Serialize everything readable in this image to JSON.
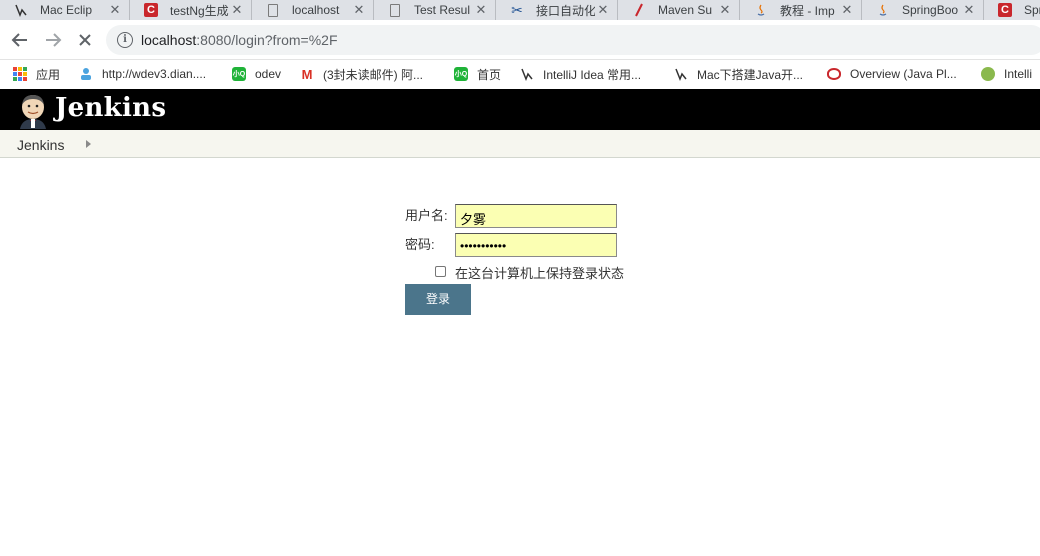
{
  "browser": {
    "tabs": [
      {
        "title": "Mac Eclip",
        "icon": "fork-icon"
      },
      {
        "title": "testNg生成",
        "icon": "c-red-icon"
      },
      {
        "title": "localhost",
        "icon": "page-icon"
      },
      {
        "title": "Test Resul",
        "icon": "page-icon"
      },
      {
        "title": "接口自动化",
        "icon": "scissors-icon"
      },
      {
        "title": "Maven Su",
        "icon": "pen-icon"
      },
      {
        "title": "教程 - Imp",
        "icon": "java-icon"
      },
      {
        "title": "SpringBoo",
        "icon": "java-icon"
      },
      {
        "title": "Spri",
        "icon": "c-red-icon"
      }
    ],
    "tab_close_glyph": "✕",
    "url_host": "localhost",
    "url_rest": ":8080/login?from=%2F",
    "bookmarks": [
      {
        "label": "应用",
        "icon": "apps-grid-icon"
      },
      {
        "label": "http://wdev3.dian....",
        "icon": "person-icon"
      },
      {
        "label": "odev",
        "icon": "green-badge-icon",
        "badge": "小Q"
      },
      {
        "label": "(3封未读邮件) 阿...",
        "icon": "gmail-icon"
      },
      {
        "label": "首页",
        "icon": "green-badge-icon",
        "badge": "小Q"
      },
      {
        "label": "IntelliJ Idea 常用...",
        "icon": "fork-icon"
      },
      {
        "label": "Mac下搭建Java开...",
        "icon": "fork-icon"
      },
      {
        "label": "Overview (Java Pl...",
        "icon": "oracle-icon"
      },
      {
        "label": "Intelli",
        "icon": "palette-icon"
      }
    ]
  },
  "jenkins": {
    "title": "Jenkins",
    "breadcrumb": "Jenkins"
  },
  "login": {
    "username_label": "用户名:",
    "username_value": "夕雾",
    "password_label": "密码:",
    "password_mask": "•••••••••••",
    "remember_label": "在这台计算机上保持登录状态",
    "remember_checked": false,
    "submit_label": "登录"
  },
  "colors": {
    "header_bg": "#000000",
    "field_bg": "#fbffb3",
    "button_bg": "#4b758b",
    "breadcrumb_bg": "#f6f6ef"
  }
}
